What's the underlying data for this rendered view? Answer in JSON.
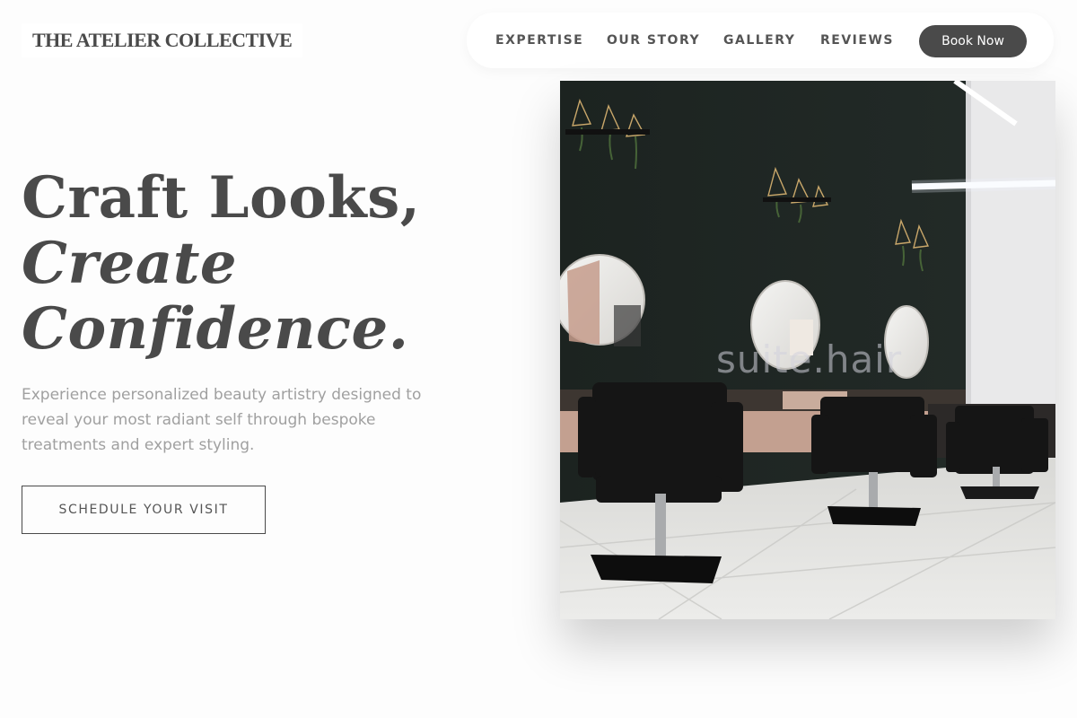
{
  "brand": {
    "name": "THE ATELIER COLLECTIVE"
  },
  "nav": {
    "links": [
      "EXPERTISE",
      "OUR STORY",
      "GALLERY",
      "REVIEWS"
    ],
    "cta_label": "Book Now"
  },
  "hero": {
    "title_line1": "Craft Looks,",
    "title_line2": "Create",
    "title_line3": "Confidence.",
    "description": "Experience personalized beauty artistry designed to reveal your most radiant self through bespoke treatments and expert styling.",
    "cta_label": "SCHEDULE YOUR VISIT"
  },
  "image": {
    "subject": "salon-interior-photo",
    "watermark": "suite.hair"
  },
  "colors": {
    "text": "#4a4a4a",
    "muted": "#a0a0a0",
    "button_bg": "#4a4a4a",
    "page_bg": "#fdfdfd"
  }
}
